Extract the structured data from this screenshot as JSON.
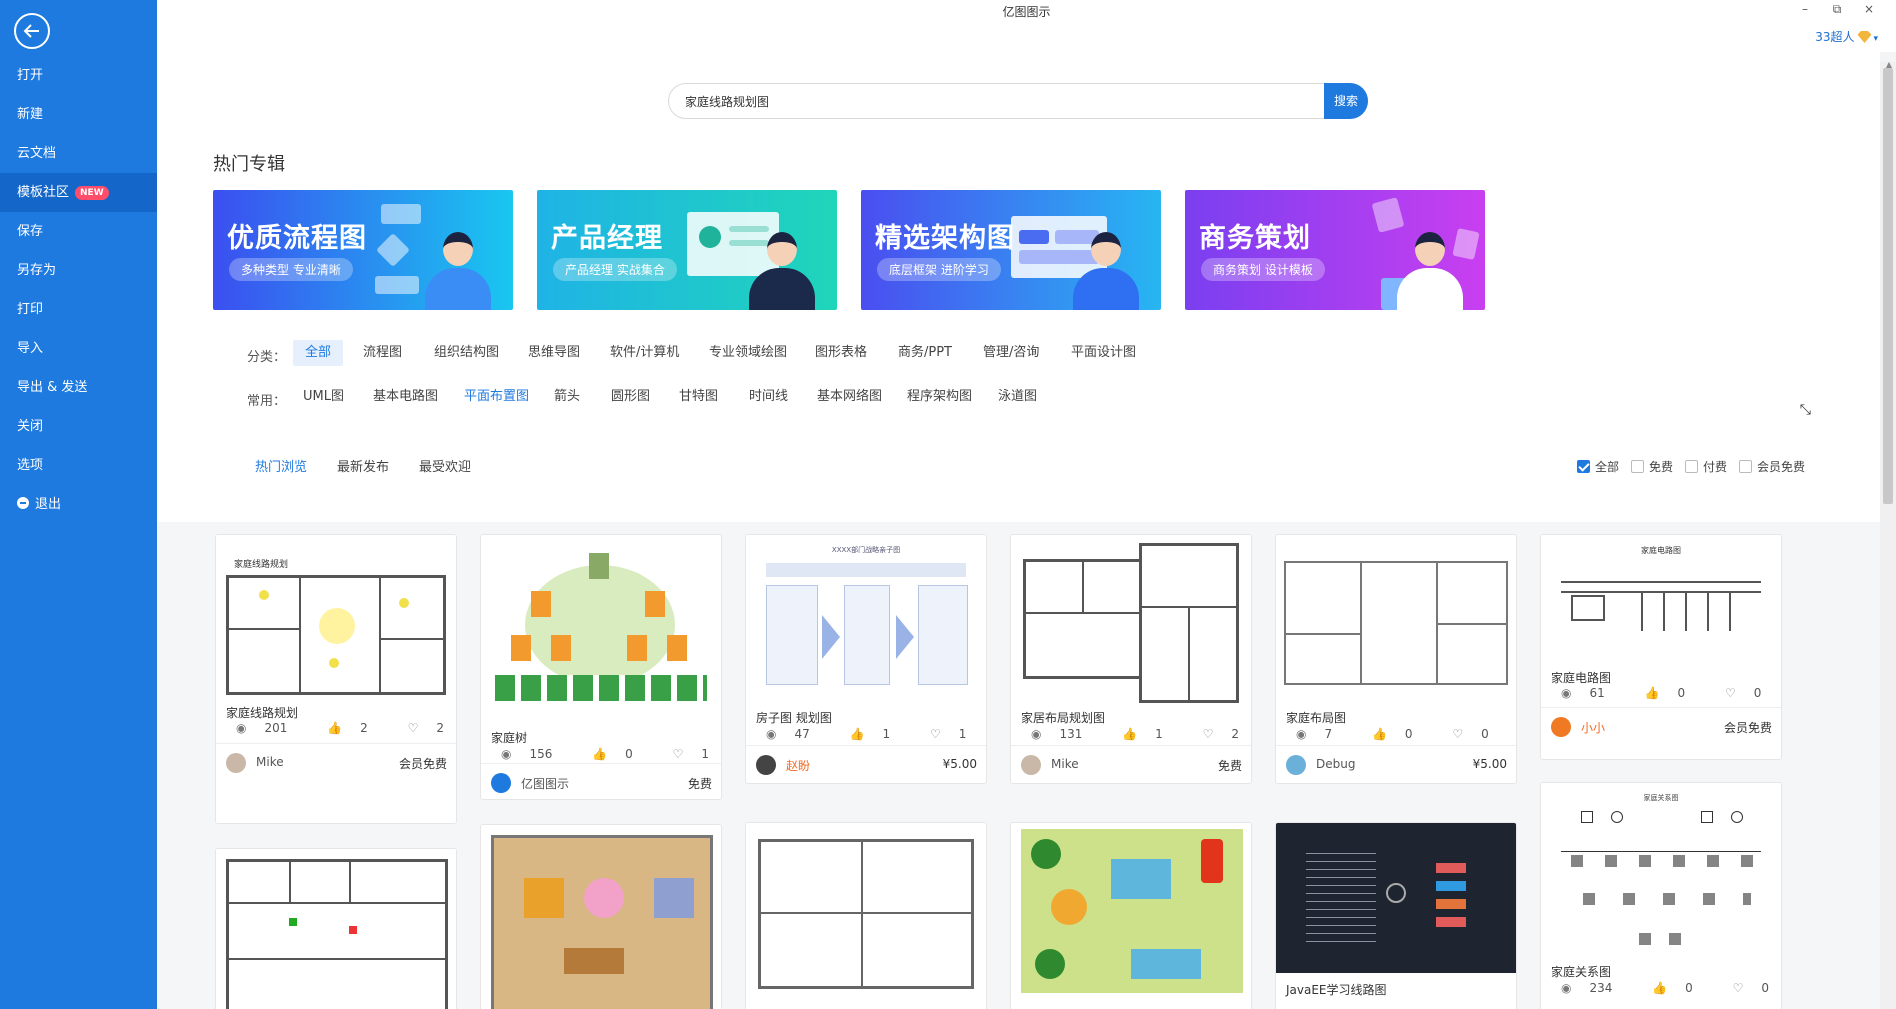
{
  "app": {
    "title": "亿图图示"
  },
  "window_controls": {
    "minimize": "–",
    "restore": "⧉",
    "close": "×"
  },
  "user": {
    "name": "33超人"
  },
  "sidebar": {
    "items": [
      {
        "label": "打开"
      },
      {
        "label": "新建"
      },
      {
        "label": "云文档"
      },
      {
        "label": "模板社区",
        "badge": "NEW",
        "active": true
      },
      {
        "label": "保存"
      },
      {
        "label": "另存为"
      },
      {
        "label": "打印"
      },
      {
        "label": "导入"
      },
      {
        "label": "导出 & 发送"
      },
      {
        "label": "关闭"
      },
      {
        "label": "选项"
      },
      {
        "label": "退出"
      }
    ]
  },
  "search": {
    "value": "家庭线路规划图",
    "button": "搜索"
  },
  "hot_section": {
    "title": "热门专辑"
  },
  "banners": [
    {
      "title": "优质流程图",
      "subtitle": "多种类型 专业清晰",
      "color_from": "#3b4ff0",
      "color_to": "#19c7f0"
    },
    {
      "title": "产品经理",
      "subtitle": "产品经理 实战集合",
      "color_from": "#1fb3e6",
      "color_to": "#1fd6b9"
    },
    {
      "title": "精选架构图",
      "subtitle": "底层框架 进阶学习",
      "color_from": "#4a4ef0",
      "color_to": "#27b6f2"
    },
    {
      "title": "商务策划",
      "subtitle": "商务策划 设计模板",
      "color_from": "#7a3ff0",
      "color_to": "#c93ff0"
    }
  ],
  "filters": {
    "category_label": "分类：",
    "categories": [
      "全部",
      "流程图",
      "组织结构图",
      "思维导图",
      "软件/计算机",
      "专业领域绘图",
      "图形表格",
      "商务/PPT",
      "管理/咨询",
      "平面设计图"
    ],
    "common_label": "常用：",
    "common": [
      "UML图",
      "基本电路图",
      "平面布置图",
      "箭头",
      "圆形图",
      "甘特图",
      "时间线",
      "基本网络图",
      "程序架构图",
      "泳道图"
    ]
  },
  "tabs": [
    "热门浏览",
    "最新发布",
    "最受欢迎"
  ],
  "price_filters": [
    "全部",
    "免费",
    "付费",
    "会员免费"
  ],
  "cards": [
    {
      "title": "家庭线路规划",
      "views": "201",
      "likes": "2",
      "favs": "2",
      "author": "Mike",
      "price": "会员免费"
    },
    {
      "title": "家庭树",
      "views": "156",
      "likes": "0",
      "favs": "1",
      "author": "亿图图示",
      "price": "免费"
    },
    {
      "title": "房子图 规划图",
      "views": "47",
      "likes": "1",
      "favs": "1",
      "author": "赵盼",
      "price": "¥5.00"
    },
    {
      "title": "家居布局规划图",
      "views": "131",
      "likes": "1",
      "favs": "2",
      "author": "Mike",
      "price": "免费"
    },
    {
      "title": "家庭布局图",
      "views": "7",
      "likes": "0",
      "favs": "0",
      "author": "Debug",
      "price": "¥5.00"
    },
    {
      "title": "家庭电路图",
      "views": "61",
      "likes": "0",
      "favs": "0",
      "author": "小小",
      "price": "会员免费"
    },
    {
      "title": "JavaEE学习线路图"
    },
    {
      "title": "家庭关系图",
      "views": "234",
      "likes": "0",
      "favs": "0"
    }
  ],
  "thumb_texts": {
    "card1": "家庭线路规划",
    "card3": "XXXX部门战略亲子图",
    "card6": "家庭电路图",
    "card8": "家庭关系图"
  }
}
